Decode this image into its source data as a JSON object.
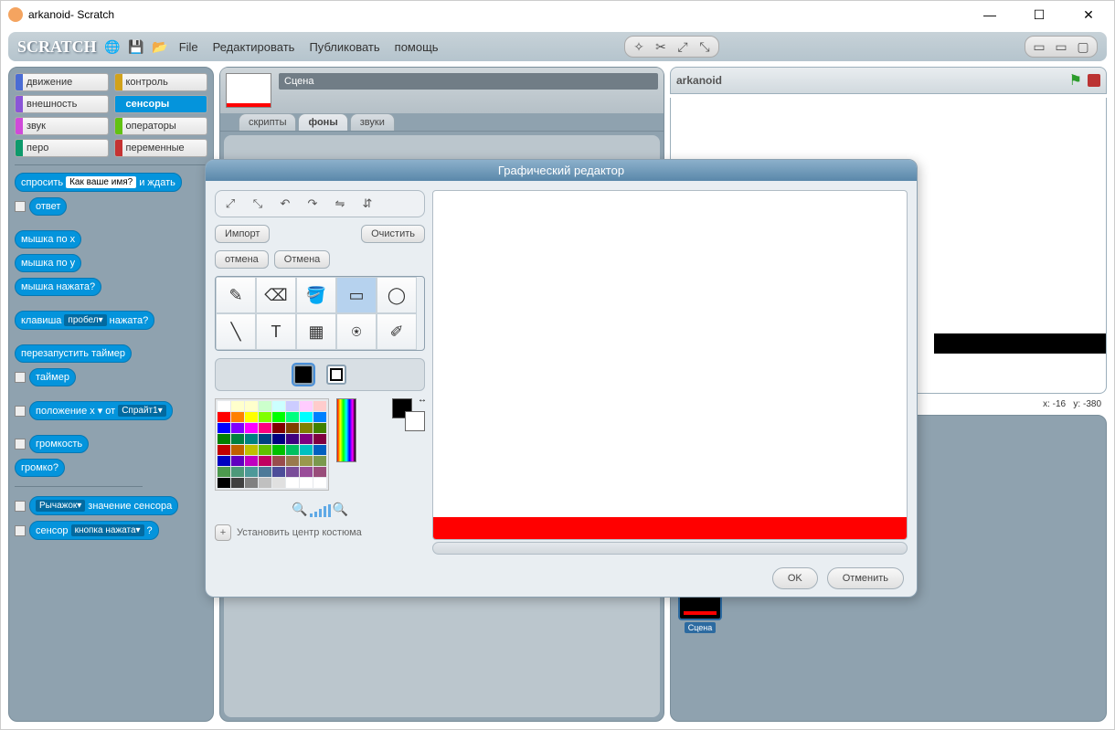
{
  "window_title": "arkanoid- Scratch",
  "logo": "SCRATCH",
  "menus": {
    "file": "File",
    "edit": "Редактировать",
    "publish": "Публиковать",
    "help": "помощь"
  },
  "categories": [
    {
      "name": "движение",
      "color": "cb-blue"
    },
    {
      "name": "контроль",
      "color": "cb-orange"
    },
    {
      "name": "внешность",
      "color": "cb-purple"
    },
    {
      "name": "сенсоры",
      "color": "cb-sensors",
      "active": true
    },
    {
      "name": "звук",
      "color": "cb-pink"
    },
    {
      "name": "операторы",
      "color": "cb-green"
    },
    {
      "name": "перо",
      "color": "cb-darkgreen"
    },
    {
      "name": "переменные",
      "color": "cb-red"
    }
  ],
  "blocks": {
    "ask_prefix": "спросить",
    "ask_value": "Как ваше имя?",
    "ask_suffix": "и ждать",
    "answer": "ответ",
    "mouse_x": "мышка по x",
    "mouse_y": "мышка по y",
    "mouse_down": "мышка нажата?",
    "key_prefix": "клавиша",
    "key_value": "пробел",
    "key_suffix": "нажата?",
    "reset_timer": "перезапустить таймер",
    "timer": "таймер",
    "pos_prefix": "положение x",
    "pos_of": "от",
    "pos_sprite": "Спрайт1",
    "loudness": "громкость",
    "loud": "громко?",
    "slider": "Рычажок",
    "sensor_value": "значение сенсора",
    "sensor": "сенсор",
    "button_pressed": "кнопка нажата",
    "q": "?"
  },
  "mid": {
    "scene": "Сцена",
    "tabs": {
      "scripts": "скрипты",
      "backgrounds": "фоны",
      "sounds": "звуки"
    }
  },
  "stage": {
    "title": "arkanoid",
    "coords_x_label": "x:",
    "coords_x": "-16",
    "coords_y_label": "y:",
    "coords_y": "-380",
    "sprite_name": "Сцена"
  },
  "dialog": {
    "title": "Графический редактор",
    "import": "Импорт",
    "clear": "Очистить",
    "undo": "отмена",
    "redo": "Отмена",
    "set_center": "Установить центр костюма",
    "ok": "OK",
    "cancel": "Отменить"
  },
  "palette": [
    "#ffffff",
    "#ffffcc",
    "#ffffcc",
    "#ccffcc",
    "#ccffff",
    "#ccccff",
    "#ffccff",
    "#ffcccc",
    "#ff0000",
    "#ff8000",
    "#ffff00",
    "#80ff00",
    "#00ff00",
    "#00ff80",
    "#00ffff",
    "#0080ff",
    "#0000ff",
    "#8000ff",
    "#ff00ff",
    "#ff0080",
    "#800000",
    "#804000",
    "#808000",
    "#408000",
    "#008000",
    "#008040",
    "#008080",
    "#004080",
    "#000080",
    "#400080",
    "#800080",
    "#800040",
    "#c00000",
    "#c06000",
    "#c0c000",
    "#60c000",
    "#00c000",
    "#00c060",
    "#00c0c0",
    "#0060c0",
    "#0000c0",
    "#6000c0",
    "#c000c0",
    "#c00060",
    "#994d4d",
    "#997a4d",
    "#99994d",
    "#7a994d",
    "#4d994d",
    "#4d997a",
    "#4d9999",
    "#4d7a99",
    "#4d4d99",
    "#7a4d99",
    "#994d99",
    "#994d7a",
    "#000000",
    "#404040",
    "#808080",
    "#c0c0c0",
    "#e0e0e0",
    "#ffffff",
    "#ffffff",
    "#ffffff"
  ]
}
